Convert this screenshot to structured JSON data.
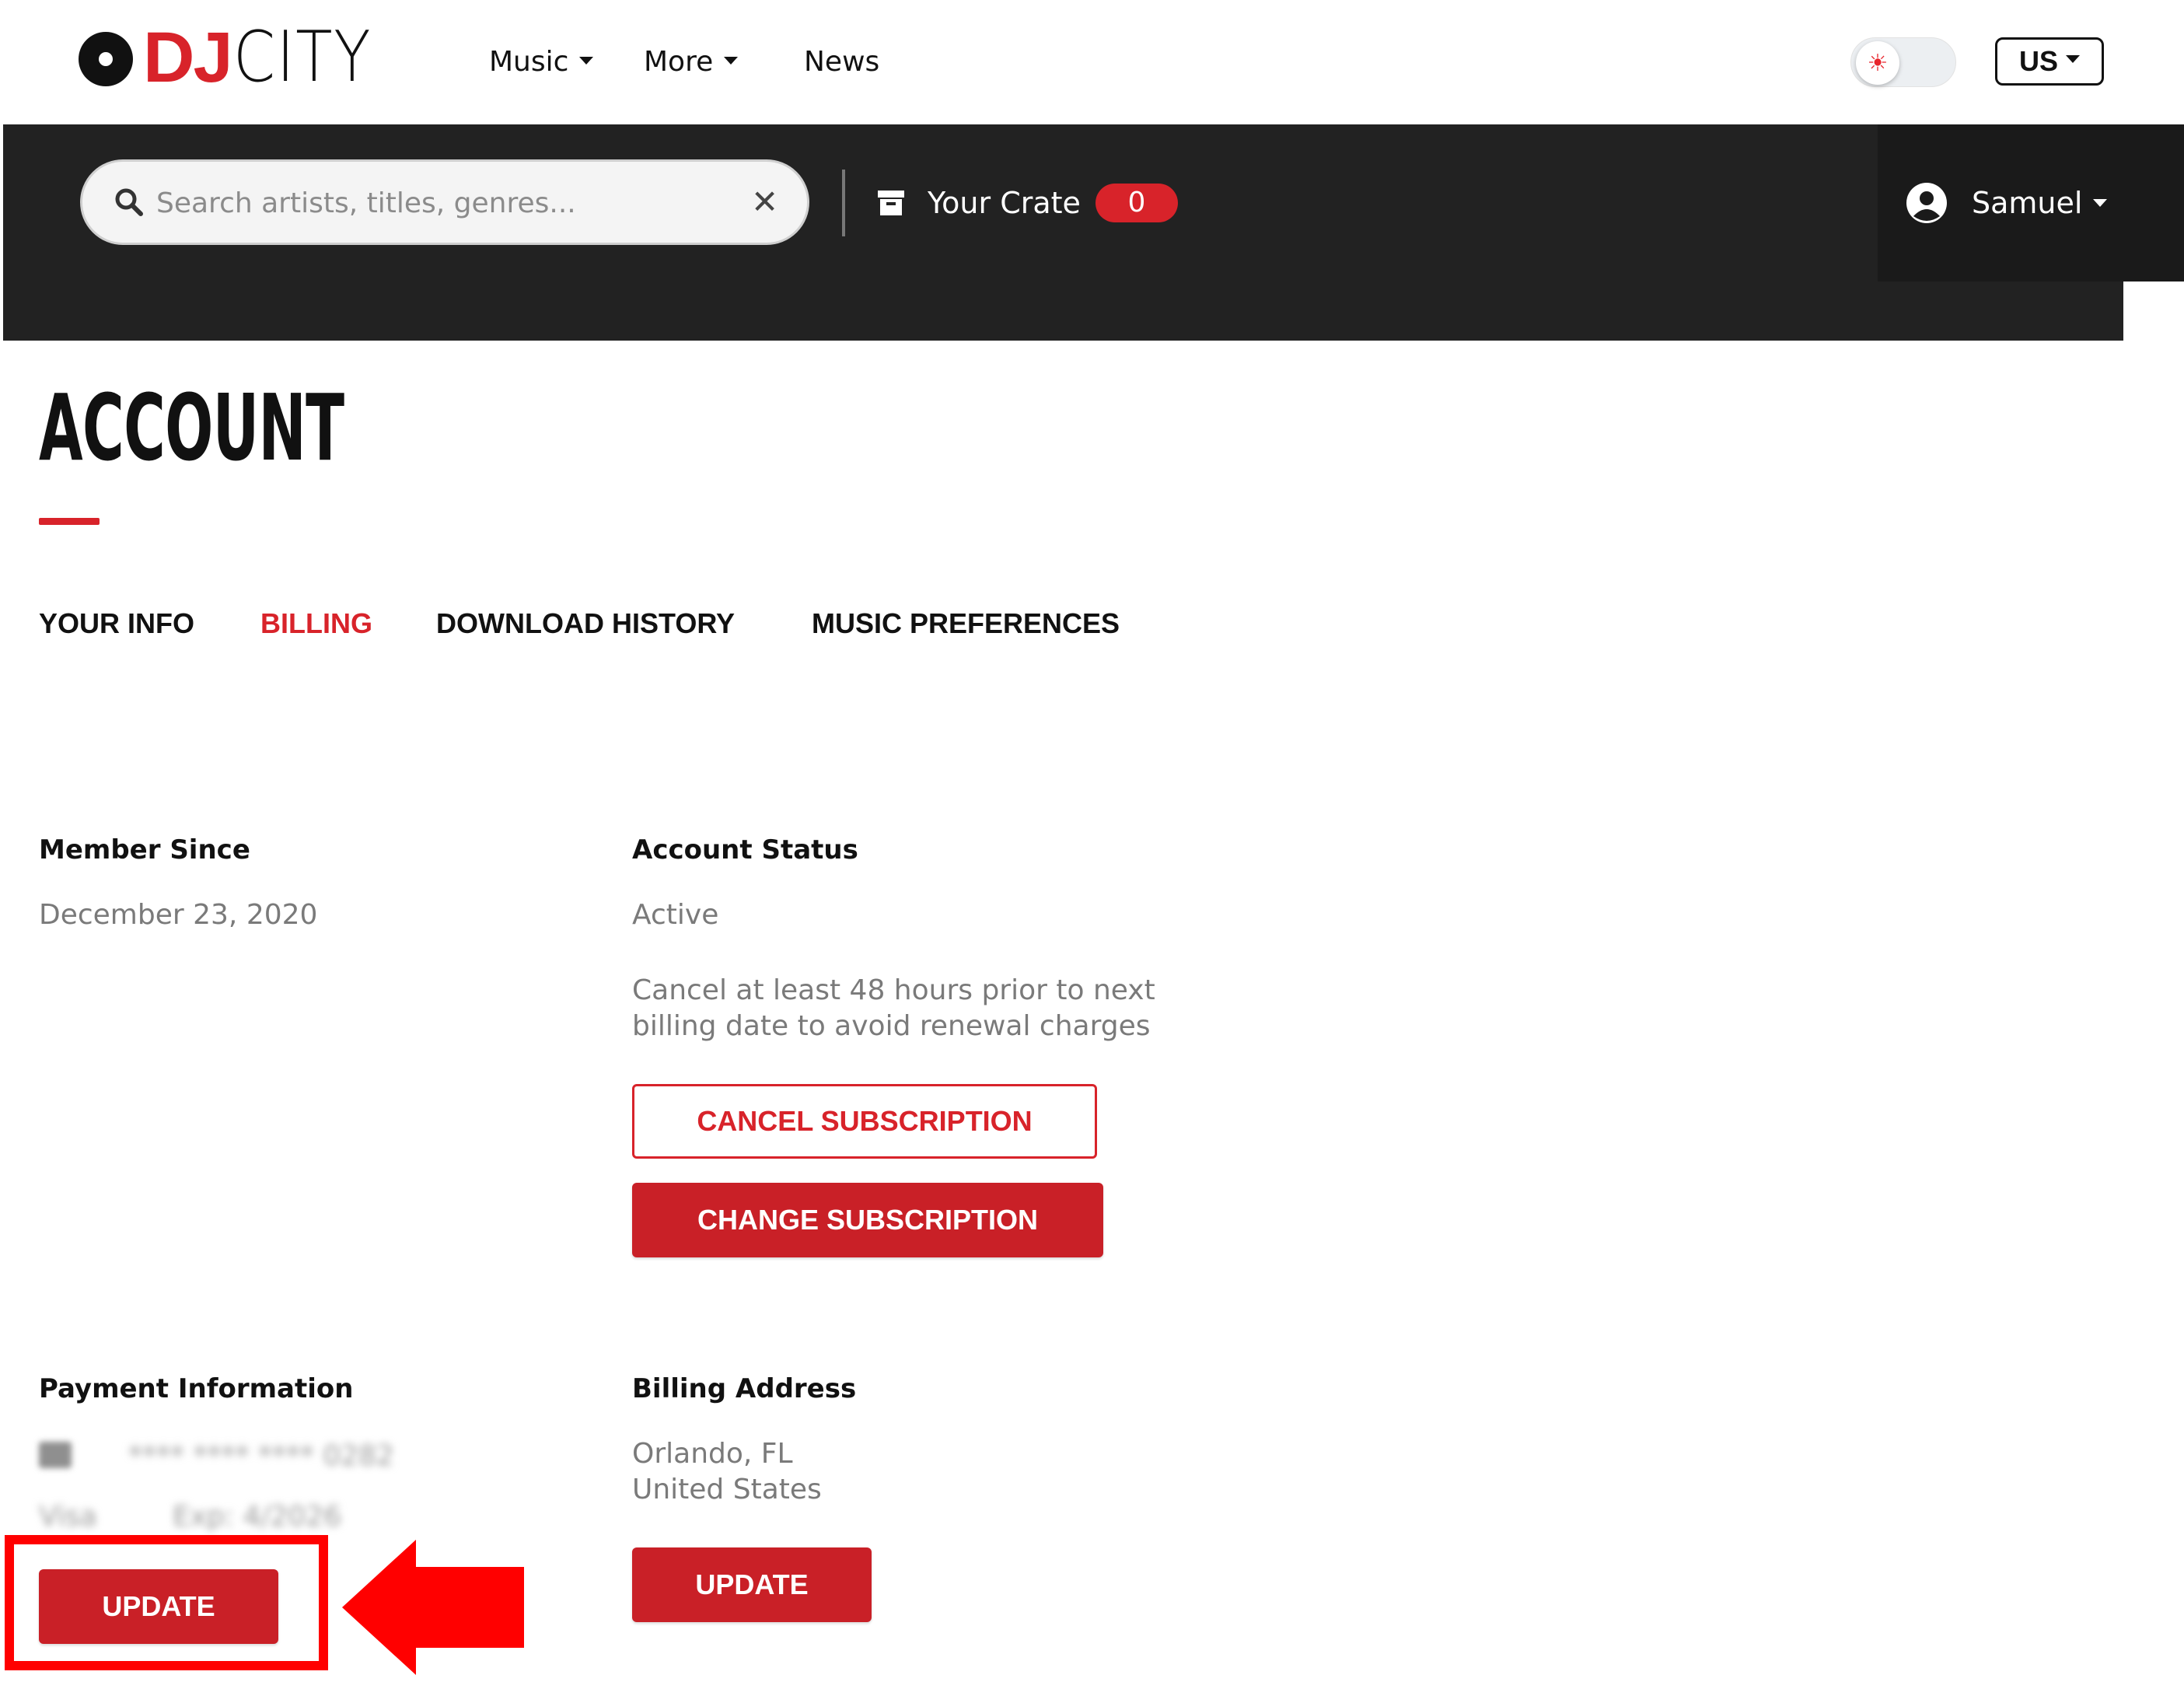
{
  "brand": {
    "dj": "DJ",
    "city": "CITY"
  },
  "nav": {
    "items": [
      "Music",
      "More",
      "News"
    ],
    "theme_toggle_icon": "sun-icon",
    "region": "US"
  },
  "searchbar": {
    "placeholder": "Search artists, titles, genres...",
    "clear": "✕"
  },
  "crate": {
    "label": "Your Crate",
    "count": "0"
  },
  "user": {
    "name": "Samuel"
  },
  "page": {
    "title": "ACCOUNT",
    "tabs": [
      "YOUR INFO",
      "BILLING",
      "DOWNLOAD HISTORY",
      "MUSIC PREFERENCES"
    ],
    "active_tab": "BILLING"
  },
  "member": {
    "label": "Member Since",
    "value": "December 23, 2020"
  },
  "status": {
    "label": "Account Status",
    "value": "Active",
    "note_line1": "Cancel at least 48 hours prior to next",
    "note_line2": "billing date to avoid renewal charges",
    "cancel_button": "CANCEL SUBSCRIPTION",
    "change_button": "CHANGE SUBSCRIPTION"
  },
  "payment": {
    "label": "Payment Information",
    "card_number": "**** **** **** 0282",
    "card_type": "Visa",
    "expiry": "Exp: 4/2026",
    "update_button": "UPDATE"
  },
  "billing_address": {
    "label": "Billing Address",
    "line1": "Orlando, FL",
    "line2": "United States",
    "update_button": "UPDATE"
  },
  "colors": {
    "brand_red": "#d8232a",
    "dark_bar": "#222222",
    "annotation_red": "#ff0000"
  }
}
